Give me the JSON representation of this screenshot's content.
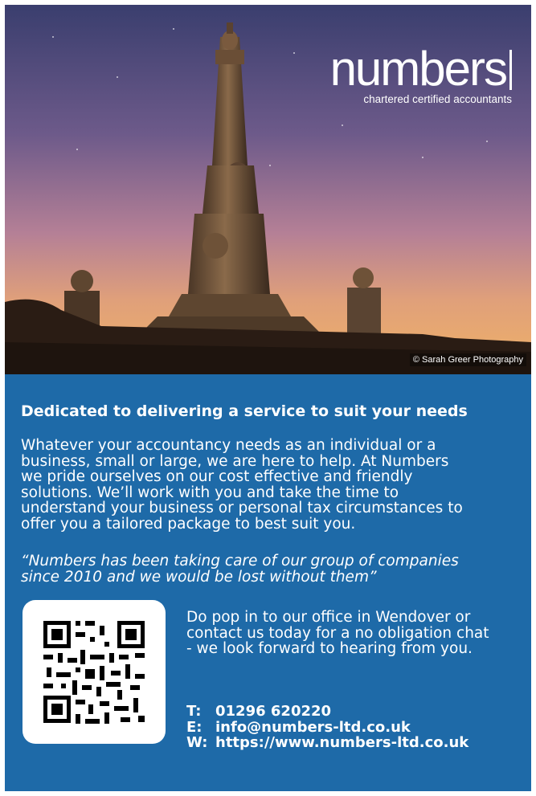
{
  "logo": {
    "wordmark": "numbers",
    "tagline": "chartered certified accountants"
  },
  "photo": {
    "credit": "© Sarah Greer Photography"
  },
  "heading": "Dedicated to delivering a service to suit your needs",
  "body": [
    "Whatever your accountancy needs as an individual or a",
    "business, small or large, we are here to help.  At Numbers",
    "we pride ourselves on our cost effective and friendly",
    "solutions. We’ll work with you and take the time to",
    "understand your business or personal tax circumstances to",
    "offer you a tailored package to best suit you."
  ],
  "quote": [
    "“Numbers has been taking care of our group of companies",
    "since 2010 and we would be lost without them”"
  ],
  "cta": [
    "Do pop in to our office in Wendover or",
    "contact us today for a no obligation chat",
    "- we look forward to hearing from you."
  ],
  "contact": {
    "phone_label": "T:",
    "phone": "01296 620220",
    "email_label": "E:",
    "email": "info@numbers-ltd.co.uk",
    "web_label": "W:",
    "web": "https://www.numbers-ltd.co.uk"
  },
  "colors": {
    "panel": "#1e6aa8",
    "text": "#ffffff"
  }
}
